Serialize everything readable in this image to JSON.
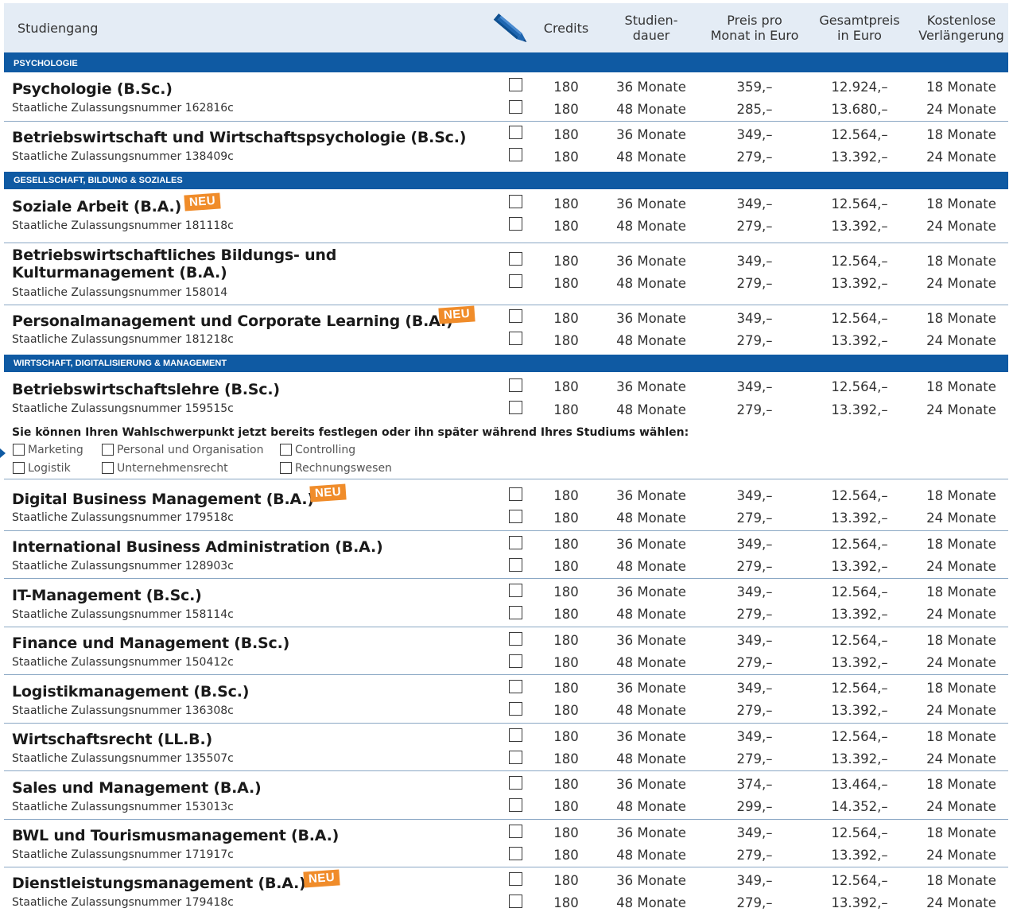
{
  "header": {
    "studiengang": "Studiengang",
    "credits": "Credits",
    "dauer": "Studien-\ndauer",
    "preis": "Preis pro\nMonat in Euro",
    "gesamt": "Gesamtpreis\nin Euro",
    "verlaengerung": "Kostenlose\nVerlängerung",
    "edit_icon": "pencil-icon"
  },
  "sections": [
    "PSYCHOLOGIE",
    "GESELLSCHAFT, BILDUNG & SOZIALES",
    "WIRTSCHAFT, DIGITALISIERUNG & MANAGEMENT"
  ],
  "badge_label": "NEU",
  "programs": [
    {
      "title": "Psychologie (B.Sc.)",
      "number": "Staatliche Zulassungsnummer 162816c",
      "new": false,
      "options": [
        {
          "credits": "180",
          "dauer": "36 Monate",
          "preis": "359,–",
          "gesamt": "12.924,–",
          "verl": "18 Monate"
        },
        {
          "credits": "180",
          "dauer": "48 Monate",
          "preis": "285,–",
          "gesamt": "13.680,–",
          "verl": "24 Monate"
        }
      ]
    },
    {
      "title": "Betriebswirtschaft und Wirtschaftspsychologie (B.Sc.)",
      "number": "Staatliche Zulassungsnummer 138409c",
      "new": false,
      "options": [
        {
          "credits": "180",
          "dauer": "36 Monate",
          "preis": "349,–",
          "gesamt": "12.564,–",
          "verl": "18 Monate"
        },
        {
          "credits": "180",
          "dauer": "48 Monate",
          "preis": "279,–",
          "gesamt": "13.392,–",
          "verl": "24 Monate"
        }
      ]
    },
    {
      "title": "Soziale Arbeit (B.A.)",
      "number": "Staatliche Zulassungsnummer 181118c",
      "new": true,
      "options": [
        {
          "credits": "180",
          "dauer": "36 Monate",
          "preis": "349,–",
          "gesamt": "12.564,–",
          "verl": "18 Monate"
        },
        {
          "credits": "180",
          "dauer": "48 Monate",
          "preis": "279,–",
          "gesamt": "13.392,–",
          "verl": "24 Monate"
        }
      ]
    },
    {
      "title": "Betriebswirtschaftliches Bildungs- und Kulturmanagement (B.A.)",
      "number": "Staatliche Zulassungsnummer 158014",
      "new": false,
      "options": [
        {
          "credits": "180",
          "dauer": "36 Monate",
          "preis": "349,–",
          "gesamt": "12.564,–",
          "verl": "18 Monate"
        },
        {
          "credits": "180",
          "dauer": "48 Monate",
          "preis": "279,–",
          "gesamt": "13.392,–",
          "verl": "24 Monate"
        }
      ]
    },
    {
      "title": "Personalmanagement und Corporate Learning (B.A.)",
      "number": "Staatliche Zulassungsnummer 181218c",
      "new": true,
      "options": [
        {
          "credits": "180",
          "dauer": "36 Monate",
          "preis": "349,–",
          "gesamt": "12.564,–",
          "verl": "18 Monate"
        },
        {
          "credits": "180",
          "dauer": "48 Monate",
          "preis": "279,–",
          "gesamt": "13.392,–",
          "verl": "24 Monate"
        }
      ]
    },
    {
      "title": "Betriebswirtschaftslehre (B.Sc.)",
      "number": "Staatliche Zulassungsnummer 159515c",
      "new": false,
      "options": [
        {
          "credits": "180",
          "dauer": "36 Monate",
          "preis": "349,–",
          "gesamt": "12.564,–",
          "verl": "18 Monate"
        },
        {
          "credits": "180",
          "dauer": "48 Monate",
          "preis": "279,–",
          "gesamt": "13.392,–",
          "verl": "24 Monate"
        }
      ]
    },
    {
      "title": "Digital Business Management (B.A.)",
      "number": "Staatliche Zulassungsnummer 179518c",
      "new": true,
      "options": [
        {
          "credits": "180",
          "dauer": "36 Monate",
          "preis": "349,–",
          "gesamt": "12.564,–",
          "verl": "18 Monate"
        },
        {
          "credits": "180",
          "dauer": "48 Monate",
          "preis": "279,–",
          "gesamt": "13.392,–",
          "verl": "24 Monate"
        }
      ]
    },
    {
      "title": "International Business Administration (B.A.)",
      "number": "Staatliche Zulassungsnummer 128903c",
      "new": false,
      "options": [
        {
          "credits": "180",
          "dauer": "36 Monate",
          "preis": "349,–",
          "gesamt": "12.564,–",
          "verl": "18 Monate"
        },
        {
          "credits": "180",
          "dauer": "48 Monate",
          "preis": "279,–",
          "gesamt": "13.392,–",
          "verl": "24 Monate"
        }
      ]
    },
    {
      "title": "IT-Management (B.Sc.)",
      "number": "Staatliche Zulassungsnummer 158114c",
      "new": false,
      "options": [
        {
          "credits": "180",
          "dauer": "36 Monate",
          "preis": "349,–",
          "gesamt": "12.564,–",
          "verl": "18 Monate"
        },
        {
          "credits": "180",
          "dauer": "48 Monate",
          "preis": "279,–",
          "gesamt": "13.392,–",
          "verl": "24 Monate"
        }
      ]
    },
    {
      "title": "Finance und Management (B.Sc.)",
      "number": "Staatliche Zulassungsnummer 150412c",
      "new": false,
      "options": [
        {
          "credits": "180",
          "dauer": "36 Monate",
          "preis": "349,–",
          "gesamt": "12.564,–",
          "verl": "18 Monate"
        },
        {
          "credits": "180",
          "dauer": "48 Monate",
          "preis": "279,–",
          "gesamt": "13.392,–",
          "verl": "24 Monate"
        }
      ]
    },
    {
      "title": "Logistikmanagement (B.Sc.)",
      "number": "Staatliche Zulassungsnummer 136308c",
      "new": false,
      "options": [
        {
          "credits": "180",
          "dauer": "36 Monate",
          "preis": "349,–",
          "gesamt": "12.564,–",
          "verl": "18 Monate"
        },
        {
          "credits": "180",
          "dauer": "48 Monate",
          "preis": "279,–",
          "gesamt": "13.392,–",
          "verl": "24 Monate"
        }
      ]
    },
    {
      "title": "Wirtschaftsrecht (LL.B.)",
      "number": "Staatliche Zulassungsnummer 135507c",
      "new": false,
      "options": [
        {
          "credits": "180",
          "dauer": "36 Monate",
          "preis": "349,–",
          "gesamt": "12.564,–",
          "verl": "18 Monate"
        },
        {
          "credits": "180",
          "dauer": "48 Monate",
          "preis": "279,–",
          "gesamt": "13.392,–",
          "verl": "24 Monate"
        }
      ]
    },
    {
      "title": "Sales und Management (B.A.)",
      "number": "Staatliche Zulassungsnummer 153013c",
      "new": false,
      "options": [
        {
          "credits": "180",
          "dauer": "36 Monate",
          "preis": "374,–",
          "gesamt": "13.464,–",
          "verl": "18 Monate"
        },
        {
          "credits": "180",
          "dauer": "48 Monate",
          "preis": "299,–",
          "gesamt": "14.352,–",
          "verl": "24 Monate"
        }
      ]
    },
    {
      "title": "BWL und Tourismusmanagement (B.A.)",
      "number": "Staatliche Zulassungsnummer 171917c",
      "new": false,
      "options": [
        {
          "credits": "180",
          "dauer": "36 Monate",
          "preis": "349,–",
          "gesamt": "12.564,–",
          "verl": "18 Monate"
        },
        {
          "credits": "180",
          "dauer": "48 Monate",
          "preis": "279,–",
          "gesamt": "13.392,–",
          "verl": "24 Monate"
        }
      ]
    },
    {
      "title": "Dienstleistungsmanagement (B.A.)",
      "number": "Staatliche Zulassungsnummer 179418c",
      "new": true,
      "options": [
        {
          "credits": "180",
          "dauer": "36 Monate",
          "preis": "349,–",
          "gesamt": "12.564,–",
          "verl": "18 Monate"
        },
        {
          "credits": "180",
          "dauer": "48 Monate",
          "preis": "279,–",
          "gesamt": "13.392,–",
          "verl": "24 Monate"
        }
      ]
    }
  ],
  "focus": {
    "question": "Sie können Ihren Wahlschwerpunkt jetzt bereits festlegen oder ihn später während Ihres Studiums wählen:",
    "options": [
      "Marketing",
      "Personal und Organisation",
      "Controlling",
      "Logistik",
      "Unternehmensrecht",
      "Rechnungswesen"
    ]
  },
  "colors": {
    "section_blue": "#0f5aa3",
    "header_bg": "#e4ecf5",
    "badge_orange": "#f08c2a"
  }
}
